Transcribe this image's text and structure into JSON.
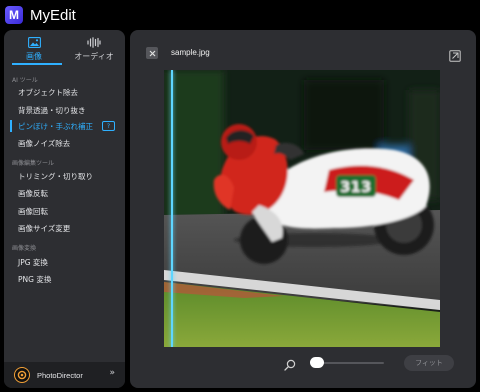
{
  "app": {
    "title": "MyEdit",
    "logo_letter": "M"
  },
  "sidebar": {
    "tabs": [
      {
        "label": "画像",
        "icon": "image-icon",
        "active": true
      },
      {
        "label": "オーディオ",
        "icon": "audio-wave-icon",
        "active": false
      }
    ],
    "sections": [
      {
        "title": "AI ツール",
        "items": [
          {
            "label": "オブジェクト除去"
          },
          {
            "label": "背景透過・切り抜き"
          },
          {
            "label": "ピンぼけ・手ぶれ補正",
            "active": true,
            "badge": "?"
          },
          {
            "label": "画像ノイズ除去"
          }
        ]
      },
      {
        "title": "画像編集ツール",
        "items": [
          {
            "label": "トリミング・切り取り"
          },
          {
            "label": "画像反転"
          },
          {
            "label": "画像回転"
          },
          {
            "label": "画像サイズ変更"
          }
        ]
      },
      {
        "title": "画像変換",
        "items": [
          {
            "label": "JPG 変換"
          },
          {
            "label": "PNG 変換"
          }
        ]
      }
    ],
    "promo": {
      "label": "PhotoDirector",
      "arrow": "»"
    }
  },
  "editor": {
    "file_name": "sample.jpg",
    "close_icon": "close-icon",
    "export_icon": "export-icon",
    "compare_line_color": "#5fd6ff",
    "fit_label": "フィット"
  },
  "colors": {
    "accent": "#2fb0ff",
    "panel": "#2d2e32",
    "background": "#000000"
  }
}
